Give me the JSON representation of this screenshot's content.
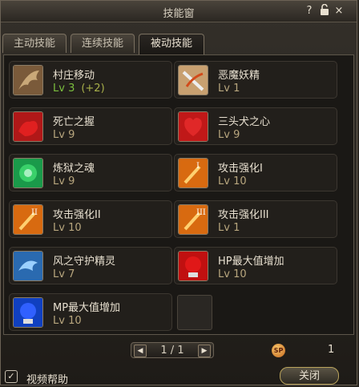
{
  "window": {
    "title": "技能窗",
    "help_glyph": "?",
    "lock_glyph": "🔓",
    "close_glyph": "×"
  },
  "tabs": [
    {
      "label": "主动技能",
      "active": false
    },
    {
      "label": "连续技能",
      "active": false
    },
    {
      "label": "被动技能",
      "active": true
    }
  ],
  "skills": [
    {
      "name": "村庄移动",
      "level": "Lv 3",
      "bonus": "(+2)",
      "icon": "wing-icon",
      "color": "#7a5a3a"
    },
    {
      "name": "恶魔妖精",
      "level": "Lv 1",
      "icon": "demon-fairy-icon",
      "color": "#c8a070"
    },
    {
      "name": "死亡之握",
      "level": "Lv 9",
      "icon": "death-grip-icon",
      "color": "#b01818"
    },
    {
      "name": "三头犬之心",
      "level": "Lv 9",
      "icon": "cerberus-heart-icon",
      "color": "#c01818"
    },
    {
      "name": "炼狱之魂",
      "level": "Lv 9",
      "icon": "purgatory-soul-icon",
      "color": "#1a9a4a"
    },
    {
      "name": "攻击强化I",
      "level": "Lv 10",
      "icon": "attack-boost-1-icon",
      "color": "#d86a10",
      "roman": "I"
    },
    {
      "name": "攻击强化II",
      "level": "Lv 10",
      "icon": "attack-boost-2-icon",
      "color": "#d86a10",
      "roman": "II"
    },
    {
      "name": "攻击强化III",
      "level": "Lv 1",
      "icon": "attack-boost-3-icon",
      "color": "#d86a10",
      "roman": "III"
    },
    {
      "name": "风之守护精灵",
      "level": "Lv 7",
      "icon": "wind-guardian-icon",
      "color": "#2a6ab0"
    },
    {
      "name": "HP最大值增加",
      "level": "Lv 10",
      "icon": "hp-potion-icon",
      "color": "#c01010"
    },
    {
      "name": "MP最大值增加",
      "level": "Lv 10",
      "icon": "mp-potion-icon",
      "color": "#1040c0"
    }
  ],
  "pager": {
    "text": "1 / 1",
    "prev": "◀",
    "next": "▶"
  },
  "sp": {
    "label": "SP",
    "value": "1"
  },
  "footer": {
    "checkbox_label": "视频帮助",
    "checked": true,
    "check_glyph": "✓",
    "close_label": "关闭"
  }
}
